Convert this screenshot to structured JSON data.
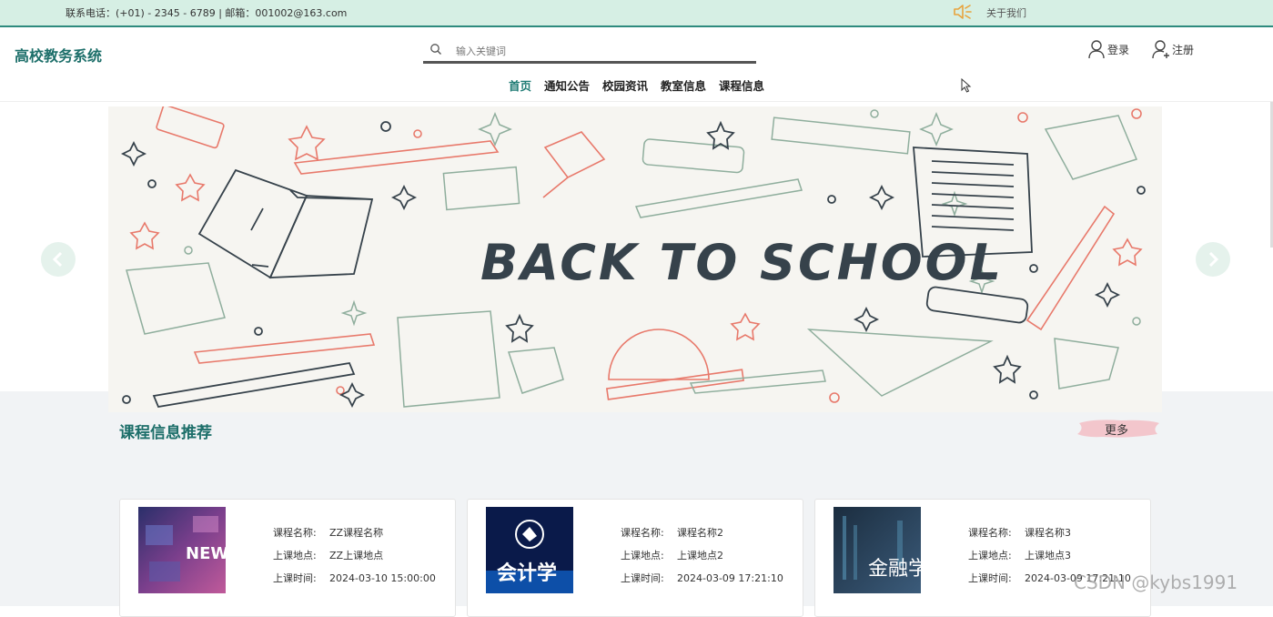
{
  "topbar": {
    "contact": "联系电话：(+01) - 2345 - 6789 | 邮箱：001002@163.com",
    "about": "关于我们"
  },
  "header": {
    "logo": "高校教务系统",
    "search_placeholder": "输入关键词",
    "login": "登录",
    "register": "注册"
  },
  "nav": [
    "首页",
    "通知公告",
    "校园资讯",
    "教室信息",
    "课程信息"
  ],
  "banner": {
    "title": "BACK TO SCHOOL"
  },
  "section": {
    "title": "课程信息推荐",
    "more": "更多"
  },
  "courses": [
    {
      "name_label": "课程名称:",
      "name": "ZZ课程名称",
      "place_label": "上课地点:",
      "place": "ZZ上课地点",
      "time_label": "上课时间:",
      "time": "2024-03-10 15:00:00",
      "thumb_text": "NEWS"
    },
    {
      "name_label": "课程名称:",
      "name": "课程名称2",
      "place_label": "上课地点:",
      "place": "上课地点2",
      "time_label": "上课时间:",
      "time": "2024-03-09 17:21:10",
      "thumb_text": "会计学"
    },
    {
      "name_label": "课程名称:",
      "name": "课程名称3",
      "place_label": "上课地点:",
      "place": "上课地点3",
      "time_label": "上课时间:",
      "time": "2024-03-09 17:21:10",
      "thumb_text": "金融学"
    }
  ],
  "watermark": "CSDN @kybs1991",
  "colors": {
    "accent": "#1d6f6a",
    "topbar": "#d6efe4"
  }
}
